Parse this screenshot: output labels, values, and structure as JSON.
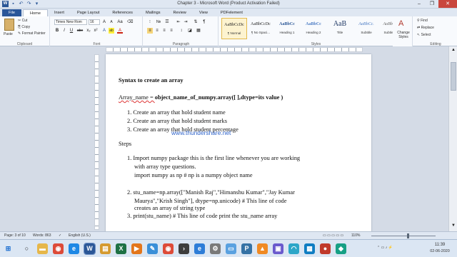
{
  "window": {
    "title": "Chapter 3  -  Microsoft Word (Product Activation Failed)",
    "qat_icons": [
      "word-logo-icon",
      "save-icon",
      "undo-icon",
      "redo-icon",
      "customize-icon"
    ],
    "controls": {
      "minimize": "–",
      "restore": "❐",
      "close": "✕"
    }
  },
  "tabs": [
    "File",
    "Home",
    "Insert",
    "Page Layout",
    "References",
    "Mailings",
    "Review",
    "View",
    "PDFelement"
  ],
  "ribbon": {
    "clipboard": {
      "paste": "Paste",
      "cut": "Cut",
      "copy": "Copy",
      "format_painter": "Format Painter",
      "label": "Clipboard"
    },
    "font": {
      "name": "Times New Rom",
      "size": "16",
      "label": "Font",
      "buttons": [
        "B",
        "I",
        "U",
        "abe",
        "x₂",
        "x²",
        "A",
        "ab",
        "A",
        "Aa"
      ]
    },
    "paragraph": {
      "label": "Paragraph",
      "buttons": [
        "≡",
        "≡",
        "≡",
        "≡",
        "↕",
        "¶"
      ]
    },
    "styles": {
      "label": "Styles",
      "items": [
        {
          "preview": "AaBbCcDc",
          "name": "¶ Normal"
        },
        {
          "preview": "AaBbCcDc",
          "name": "¶ No Spaci..."
        },
        {
          "preview": "AaBbCc",
          "name": "Heading 1"
        },
        {
          "preview": "AaBbCc",
          "name": "Heading 2"
        },
        {
          "preview": "AaB",
          "name": "Title"
        },
        {
          "preview": "AaBbCc.",
          "name": "Subtitle"
        },
        {
          "preview": "AaBbCcDc",
          "name": "Subtle Em..."
        }
      ],
      "change_styles": "Change Styles"
    },
    "editing": {
      "find": "Find",
      "replace": "Replace",
      "select": "Select",
      "label": "Editing"
    }
  },
  "document": {
    "heading": "Syntax to create an array",
    "syntax_a": "Array_name = ",
    "syntax_b": "object_name_of_numpy.array([ ],dtype=its  value )",
    "list1": [
      "1.  Create an array that hold student name",
      "2.  Create an array that hold student marks",
      "3.  Create an array that hold student percentage"
    ],
    "watermark": "www.thundershare.net",
    "steps_label": "Steps",
    "step1_a": "1.  Import numpy package    this is the first line whenever you are working",
    "step1_b": "with array type questions.",
    "step1_c": "import numpy as np     # np is a numpy object name",
    "step2_a": "2.  stu_name=np.array([\"Manish Raj\",\"Himanshu  Kumar\",\"Jay  Kumar",
    "step2_b": "Maurya\",\"Krish Singh\"], dtype=np.unicode)    # This line of code",
    "step2_c": "creates  an array of string type",
    "step3": "3.  print(stu_name)        # This line of code print the stu_name array"
  },
  "status": {
    "page": "Page: 3 of 10",
    "words": "Words: 863",
    "language": "English (U.S.)",
    "zoom": "110%"
  },
  "taskbar": {
    "icons": [
      "start-icon",
      "search-icon",
      "file-explorer-icon",
      "chrome-icon",
      "edge-icon",
      "word-icon",
      "folder-icon",
      "excel-icon",
      "media-icon",
      "paint-icon",
      "chrome-icon-2",
      "terminal-icon",
      "ie-icon",
      "settings-icon",
      "notepad-icon",
      "python-icon",
      "vlc-icon",
      "store-icon",
      "wifi-icon",
      "photos-icon",
      "recorder-icon",
      "app-icon"
    ],
    "time": "11:39",
    "date": "02-06-2020"
  }
}
